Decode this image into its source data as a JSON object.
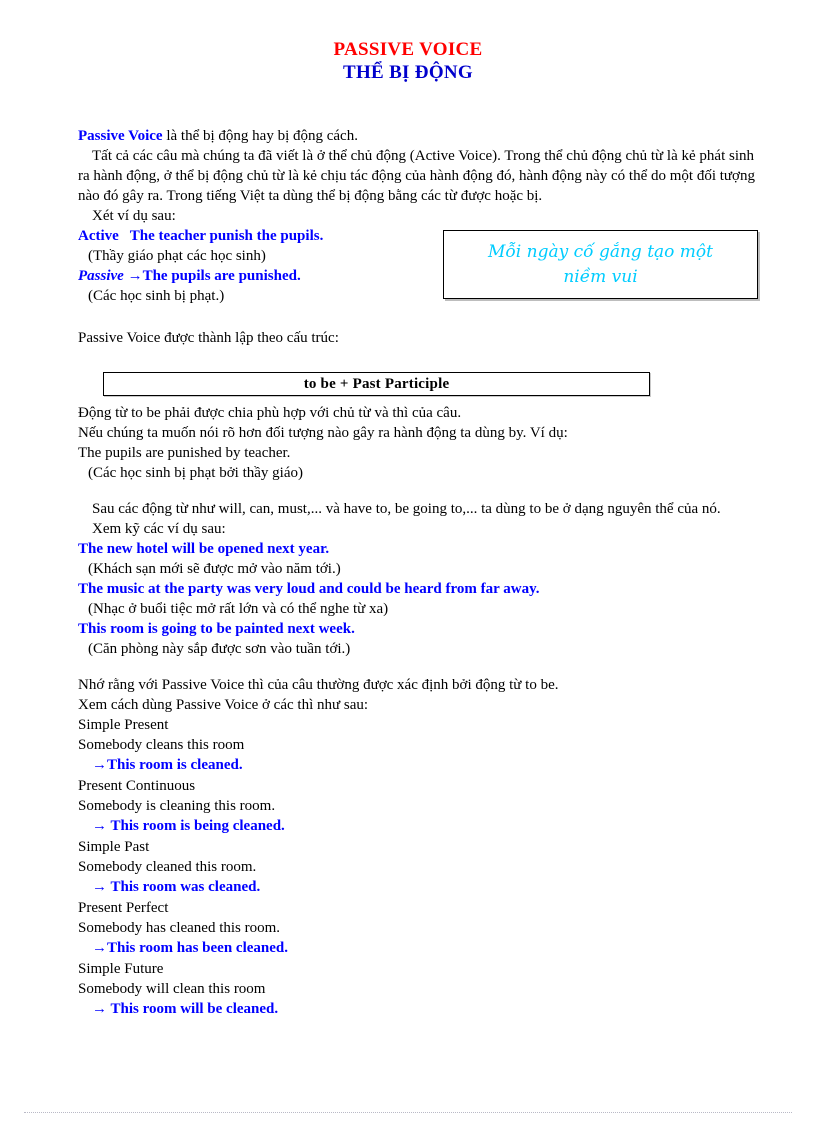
{
  "document": {
    "title_en": "PASSIVE VOICE",
    "title_vi": "THỂ BỊ ĐỘNG",
    "title_color_en": "#FF0000",
    "title_color_vi": "#0000CC",
    "accent_blue": "#0000FF",
    "quote_color": "#00CCFF"
  },
  "intro": {
    "line1_lead": "Passive Voice",
    "line1_rest": " là thể bị động hay bị động cách.",
    "paragraph": "Tất cả các câu mà chúng ta đã viết là ở thể chủ động (Active Voice). Trong thể chủ động chủ từ là kẻ phát sinh ra hành động, ở thể bị động chủ từ là kẻ chịu tác động của hành động đó, hành động này có thể do một đối tượng nào đó gây ra. Trong tiếng Việt ta dùng thể bị động bằng các từ được hoặc bị.",
    "see_example": "Xét ví dụ sau:"
  },
  "example_pair": {
    "active_label": "Active",
    "active_sentence": "The teacher punish the pupils.",
    "active_translation": "(Thầy giáo phạt các học sinh)",
    "passive_label": "Passive",
    "passive_arrow": "→",
    "passive_sentence": "The pupils are punished.",
    "passive_translation": "(Các học sinh bị phạt.)"
  },
  "quote_box": {
    "line1": "Mỗi ngày cố gắng tạo một",
    "line2": "niềm vui"
  },
  "structure": {
    "intro_line": "Passive Voice được thành lập theo cấu trúc:",
    "formula": "to be + Past Participle",
    "note1": "Động từ to be phải được chia phù hợp với chủ từ và thì của câu.",
    "note2": "Nếu chúng ta muốn nói rõ hơn đối tượng nào gây ra hành động ta dùng by. Ví dụ:",
    "example_en": "The pupils are punished by teacher.",
    "example_vi": "(Các học sinh bị phạt bởi thầy giáo)"
  },
  "modals": {
    "note": "Sau các động từ như will, can, must,... và have to, be going to,... ta dùng to be ở dạng nguyên thể của nó.",
    "see_examples": "Xem kỹ các ví dụ sau:",
    "examples": [
      {
        "en": "The new hotel will be opened next year.",
        "vi": "(Khách sạn mới sẽ được mở vào năm tới.)"
      },
      {
        "en": "The music at the party was very loud and could be heard from far away.",
        "vi": "(Nhạc ở buổi tiệc mở rất lớn và có thể nghe từ xa)"
      },
      {
        "en": "This room is going to be painted next week.",
        "vi": "(Căn phòng này sắp được sơn vào tuần tới.)"
      }
    ]
  },
  "tenses_section": {
    "note1": "Nhớ rằng với Passive Voice thì của câu thường được xác định bởi động từ to be.",
    "note2": "Xem cách dùng Passive Voice ở các thì như sau:",
    "arrow": "→",
    "items": [
      {
        "name": "Simple Present",
        "active": "Somebody cleans this room",
        "passive": "This room is cleaned."
      },
      {
        "name": "Present Continuous",
        "active": "Somebody is cleaning this room.",
        "passive": "This room is being cleaned."
      },
      {
        "name": "Simple Past",
        "active": "Somebody cleaned this room.",
        "passive": "This room was cleaned."
      },
      {
        "name": "Present Perfect",
        "active": "Somebody has cleaned this room.",
        "passive": "This room has been cleaned."
      },
      {
        "name": "Simple Future",
        "active": "Somebody will clean this room",
        "passive": "This room will be cleaned."
      }
    ]
  }
}
